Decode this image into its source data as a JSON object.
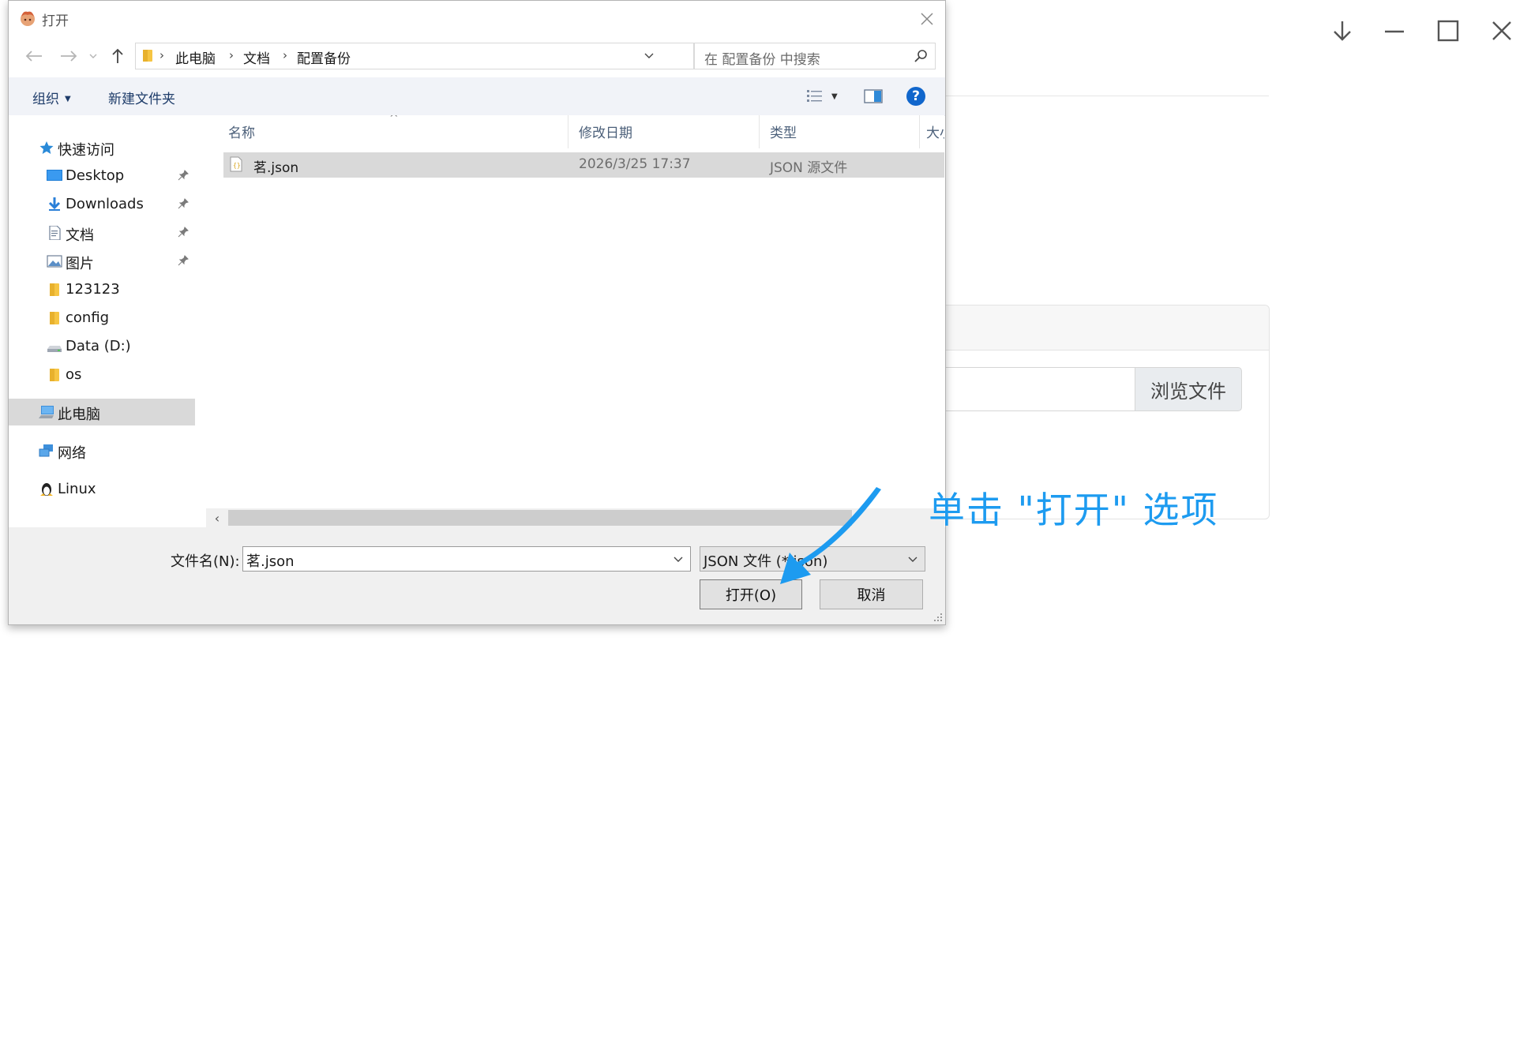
{
  "background_app": {
    "browse_button_label": "浏览文件"
  },
  "dialog": {
    "title": "打开",
    "breadcrumb": [
      "此电脑",
      "文档",
      "配置备份"
    ],
    "search_placeholder": "在 配置备份 中搜索",
    "toolbar": {
      "organize_label": "组织",
      "new_folder_label": "新建文件夹"
    },
    "nav_items": [
      {
        "label": "快速访问",
        "icon": "star-icon",
        "pinned": false
      },
      {
        "label": "Desktop",
        "icon": "desktop-icon",
        "pinned": true
      },
      {
        "label": "Downloads",
        "icon": "download-icon",
        "pinned": true
      },
      {
        "label": "文档",
        "icon": "document-icon",
        "pinned": true
      },
      {
        "label": "图片",
        "icon": "pictures-icon",
        "pinned": true
      },
      {
        "label": "123123",
        "icon": "folder-icon",
        "pinned": false
      },
      {
        "label": "config",
        "icon": "folder-icon",
        "pinned": false
      },
      {
        "label": "Data (D:)",
        "icon": "drive-icon",
        "pinned": false
      },
      {
        "label": "os",
        "icon": "folder-icon",
        "pinned": false
      },
      {
        "label": "此电脑",
        "icon": "computer-icon",
        "pinned": false,
        "selected": true
      },
      {
        "label": "网络",
        "icon": "network-icon",
        "pinned": false
      },
      {
        "label": "Linux",
        "icon": "linux-icon",
        "pinned": false
      }
    ],
    "columns": [
      "名称",
      "修改日期",
      "类型",
      "大小"
    ],
    "files": [
      {
        "name": "茗.json",
        "modified": "2026/3/25 17:37",
        "type": "JSON 源文件",
        "selected": true
      }
    ],
    "filename_label": "文件名(N):",
    "filename_value": "茗.json",
    "filetype_value": "JSON 文件 (*.json)",
    "open_button_label": "打开(O)",
    "cancel_button_label": "取消"
  },
  "annotation": {
    "text": "单击 \"打开\" 选项",
    "color": "#1d9bf0"
  }
}
